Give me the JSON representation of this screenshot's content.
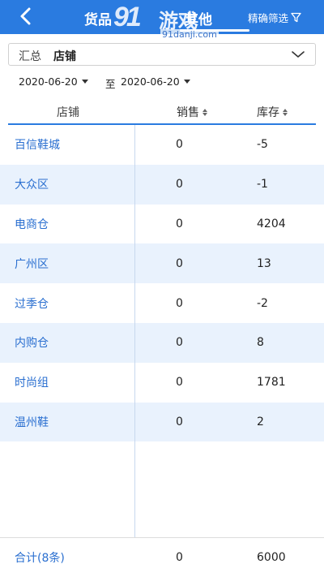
{
  "header": {
    "tab_goods": "货品",
    "tab_other": "其他",
    "filter_label": "精确筛选",
    "watermark_num": "91",
    "watermark_text": "游戏",
    "watermark_url": "91danji.com",
    "bg_color": "#2a7be0"
  },
  "summary": {
    "label": "汇总",
    "value": "店铺"
  },
  "date_range": {
    "start": "2020-06-20",
    "separator": "至",
    "end": "2020-06-20"
  },
  "table": {
    "columns": {
      "store": "店铺",
      "sales": "销售",
      "stock": "库存"
    },
    "rows": [
      {
        "store": "百信鞋城",
        "sales": "0",
        "stock": "-5"
      },
      {
        "store": "大众区",
        "sales": "0",
        "stock": "-1"
      },
      {
        "store": "电商仓",
        "sales": "0",
        "stock": "4204"
      },
      {
        "store": "广州区",
        "sales": "0",
        "stock": "13"
      },
      {
        "store": "过季仓",
        "sales": "0",
        "stock": "-2"
      },
      {
        "store": "内购仓",
        "sales": "0",
        "stock": "8"
      },
      {
        "store": "时尚组",
        "sales": "0",
        "stock": "1781"
      },
      {
        "store": "温州鞋",
        "sales": "0",
        "stock": "2"
      }
    ],
    "footer": {
      "label": "合计(8条)",
      "sales": "0",
      "stock": "6000"
    }
  }
}
